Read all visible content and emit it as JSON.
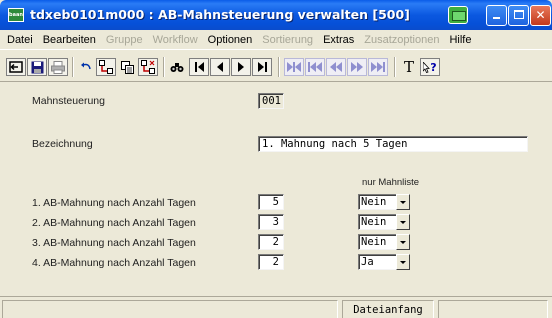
{
  "window": {
    "title": "tdxeb0101m000 : AB-Mahnsteuerung verwalten [500]",
    "app_icon_text": "baan"
  },
  "menu": [
    {
      "label": "Datei",
      "enabled": true
    },
    {
      "label": "Bearbeiten",
      "enabled": true
    },
    {
      "label": "Gruppe",
      "enabled": false
    },
    {
      "label": "Workflow",
      "enabled": false
    },
    {
      "label": "Optionen",
      "enabled": true
    },
    {
      "label": "Sortierung",
      "enabled": false
    },
    {
      "label": "Extras",
      "enabled": true
    },
    {
      "label": "Zusatzoptionen",
      "enabled": false
    },
    {
      "label": "Hilfe",
      "enabled": true
    }
  ],
  "toolbar": {
    "icons": [
      "exit-icon",
      "save-icon",
      "print-icon",
      "undo-icon",
      "insert-record-icon",
      "copy-record-icon",
      "delete-record-icon",
      "find-icon",
      "first-record-icon",
      "previous-record-icon",
      "next-record-icon",
      "last-record-icon",
      "first-set-icon",
      "previous-set-icon",
      "previous-group-icon",
      "next-group-icon",
      "last-set-icon",
      "text-icon",
      "context-help-icon"
    ],
    "text_button": "T",
    "help_button": "?"
  },
  "form": {
    "mahnsteuerung_label": "Mahnsteuerung",
    "mahnsteuerung_value": "001",
    "bezeichnung_label": "Bezeichnung",
    "bezeichnung_value": "1. Mahnung nach 5 Tagen",
    "nur_mahnliste_header": "nur Mahnliste",
    "rows": [
      {
        "label": "1. AB-Mahnung nach Anzahl Tagen",
        "days": "5",
        "nur_mahnliste": "Nein"
      },
      {
        "label": "2. AB-Mahnung nach Anzahl Tagen",
        "days": "3",
        "nur_mahnliste": "Nein"
      },
      {
        "label": "3. AB-Mahnung nach Anzahl Tagen",
        "days": "2",
        "nur_mahnliste": "Nein"
      },
      {
        "label": "4. AB-Mahnung nach Anzahl Tagen",
        "days": "2",
        "nur_mahnliste": "Ja"
      }
    ]
  },
  "status": {
    "position_text": "Dateianfang"
  },
  "colors": {
    "titlebar": "#0b58e0",
    "window_bg": "#ece9d8",
    "disabled_text": "#a7a697"
  }
}
